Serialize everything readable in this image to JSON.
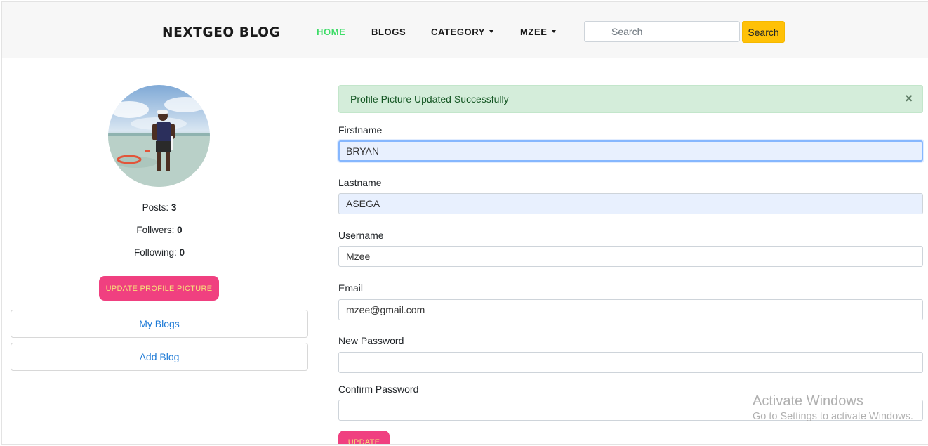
{
  "navbar": {
    "brand": "NEXTGEO BLOG",
    "links": [
      {
        "label": "HOME",
        "active": true
      },
      {
        "label": "BLOGS",
        "active": false
      },
      {
        "label": "CATEGORY",
        "dropdown": true
      },
      {
        "label": "MZEE",
        "dropdown": true
      }
    ],
    "search": {
      "placeholder": "Search",
      "button_label": "Search"
    }
  },
  "profile": {
    "avatar_icon": "profile-photo",
    "stats": [
      {
        "label": "Posts:",
        "value": "3"
      },
      {
        "label": "Follwers:",
        "value": "0"
      },
      {
        "label": "Following:",
        "value": "0"
      }
    ],
    "update_picture_label": "UPDATE PROFILE PICTURE",
    "menu": [
      {
        "label": "My Blogs"
      },
      {
        "label": "Add Blog"
      }
    ]
  },
  "alert": {
    "message": "Profile Picture Updated Successfully",
    "close_symbol": "×"
  },
  "form": {
    "fields": [
      {
        "label": "Firstname",
        "value": "BRYAN"
      },
      {
        "label": "Lastname",
        "value": "ASEGA"
      },
      {
        "label": "Username",
        "value": "Mzee"
      },
      {
        "label": "Email",
        "value": "mzee@gmail.com"
      },
      {
        "label": "New Password",
        "value": ""
      },
      {
        "label": "Confirm Password",
        "value": ""
      }
    ],
    "submit_label": "UPDATE"
  },
  "watermark": {
    "title": "Activate Windows",
    "subtitle": "Go to Settings to activate Windows."
  },
  "colors": {
    "brand_active": "#3ddc67",
    "search_button": "#ffc107",
    "accent_pink": "#f04080",
    "link_blue": "#1e7ad6",
    "alert_bg": "#d4edda"
  }
}
